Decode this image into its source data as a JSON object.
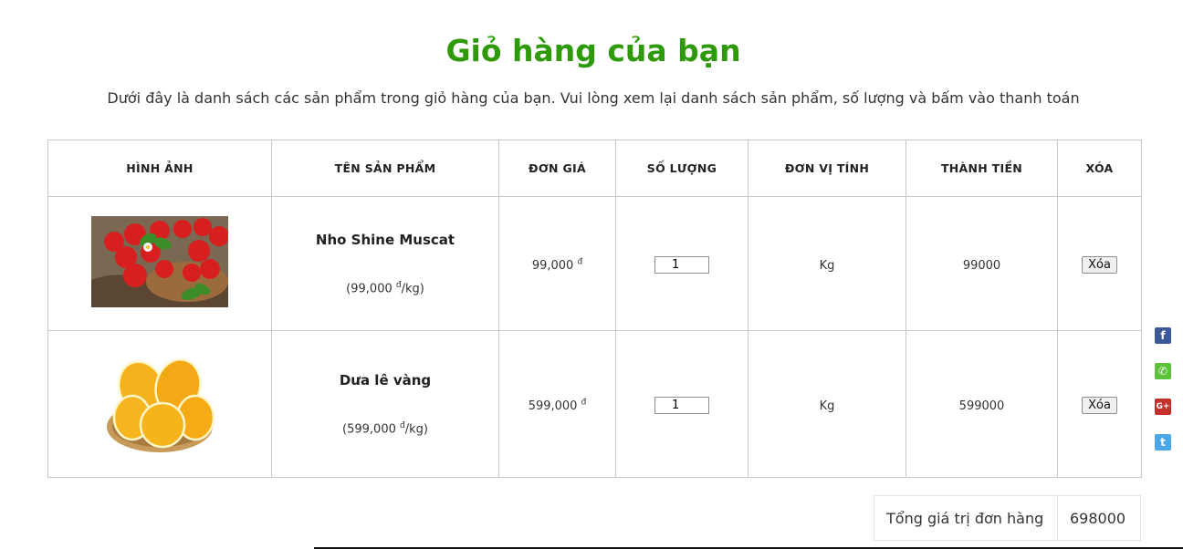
{
  "page": {
    "title": "Giỏ hàng của bạn",
    "subtitle": "Dưới đây là danh sách các sản phẩm trong giỏ hàng của bạn. Vui lòng xem lại danh sách sản phẩm, số lượng và bấm vào thanh toán"
  },
  "table": {
    "headers": [
      "HÌNH ẢNH",
      "TÊN SẢN PHẨM",
      "ĐƠN GIÁ",
      "SỐ LƯỢNG",
      "ĐƠN VỊ TÍNH",
      "THÀNH TIỀN",
      "XÓA"
    ],
    "rows": [
      {
        "image": "strawberries-image",
        "name": "Nho Shine Muscat",
        "unit_price_prefix": "(99,000 ",
        "unit_price_suffix": "/kg)",
        "price": "99,000",
        "currency": "đ",
        "quantity": "1",
        "unit": "Kg",
        "subtotal": "99000",
        "delete_label": "Xóa"
      },
      {
        "image": "yellow-melon-image",
        "name": "Dưa lê vàng",
        "unit_price_prefix": "(599,000 ",
        "unit_price_suffix": "/kg)",
        "price": "599,000",
        "currency": "đ",
        "quantity": "1",
        "unit": "Kg",
        "subtotal": "599000",
        "delete_label": "Xóa"
      }
    ]
  },
  "total": {
    "label": "Tổng giá trị đơn hàng",
    "value": "698000"
  },
  "social": [
    {
      "icon": "facebook-icon",
      "glyph": "f",
      "color": "#3b5998"
    },
    {
      "icon": "phone-icon",
      "glyph": "✆",
      "color": "#5cc13b"
    },
    {
      "icon": "google-plus-icon",
      "glyph": "G+",
      "color": "#c4302b"
    },
    {
      "icon": "twitter-icon",
      "glyph": "t",
      "color": "#4aa8e8"
    }
  ],
  "colors": {
    "title": "#2e9a0a"
  }
}
